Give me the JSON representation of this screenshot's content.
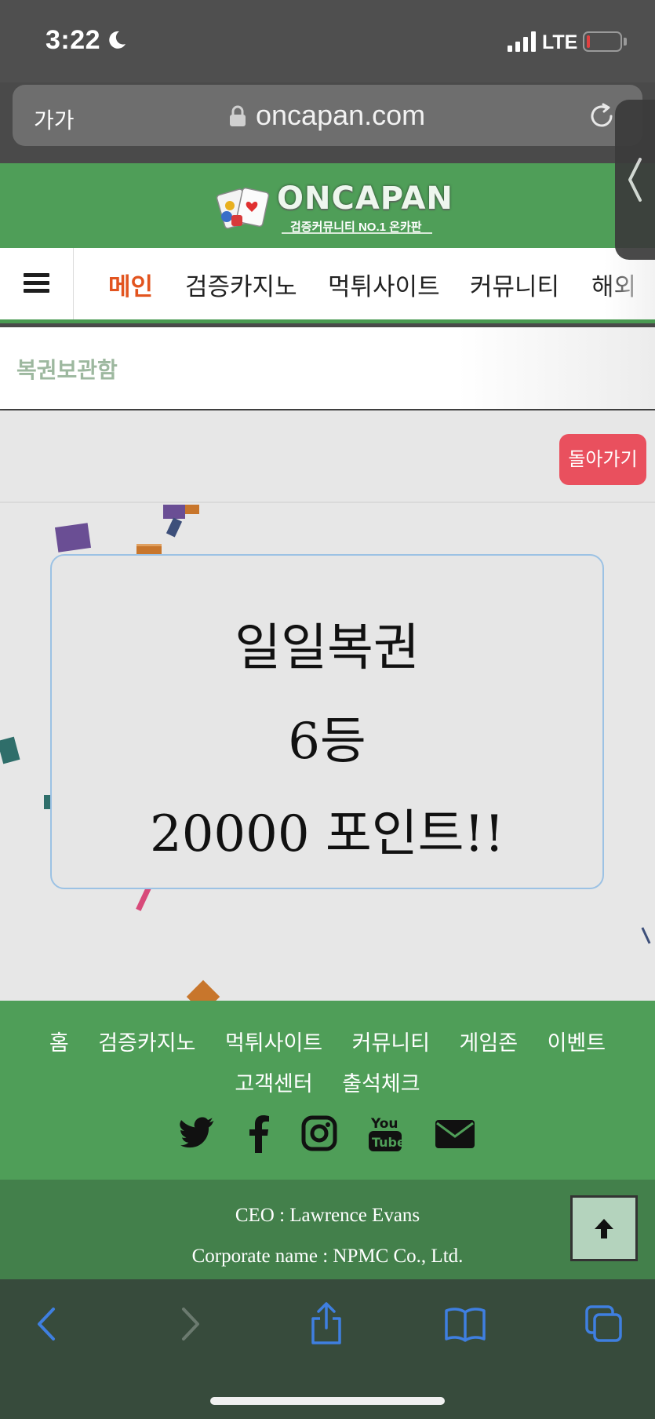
{
  "status_bar": {
    "time": "3:22",
    "network": "LTE"
  },
  "browser": {
    "text_size_label": "가가",
    "url": "oncapan.com"
  },
  "site": {
    "logo_text": "ONCAPAN",
    "logo_subtitle": "검증커뮤니티 NO.1 온카판",
    "nav": [
      "메인",
      "검증카지노",
      "먹튀사이트",
      "커뮤니티",
      "해외"
    ],
    "active_nav": "메인",
    "page_title": "복권보관함",
    "back_button": "돌아가기"
  },
  "result": {
    "line1": "일일복권",
    "line2": "6등",
    "line3": "20000 포인트!!"
  },
  "footer": {
    "links": [
      "홈",
      "검증카지노",
      "먹튀사이트",
      "커뮤니티",
      "게임존",
      "이벤트"
    ],
    "links_row2": [
      "고객센터",
      "출석체크"
    ],
    "social_icons": [
      "twitter-icon",
      "facebook-icon",
      "instagram-icon",
      "youtube-icon",
      "email-icon"
    ],
    "ceo": "CEO : Lawrence Evans",
    "corporate": "Corporate name : NPMC Co., Ltd."
  },
  "colors": {
    "brand_green": "#4f9e58",
    "active_nav": "#e2541f",
    "back_button": "#e9505e",
    "ios_blue": "#3f7fe0"
  }
}
